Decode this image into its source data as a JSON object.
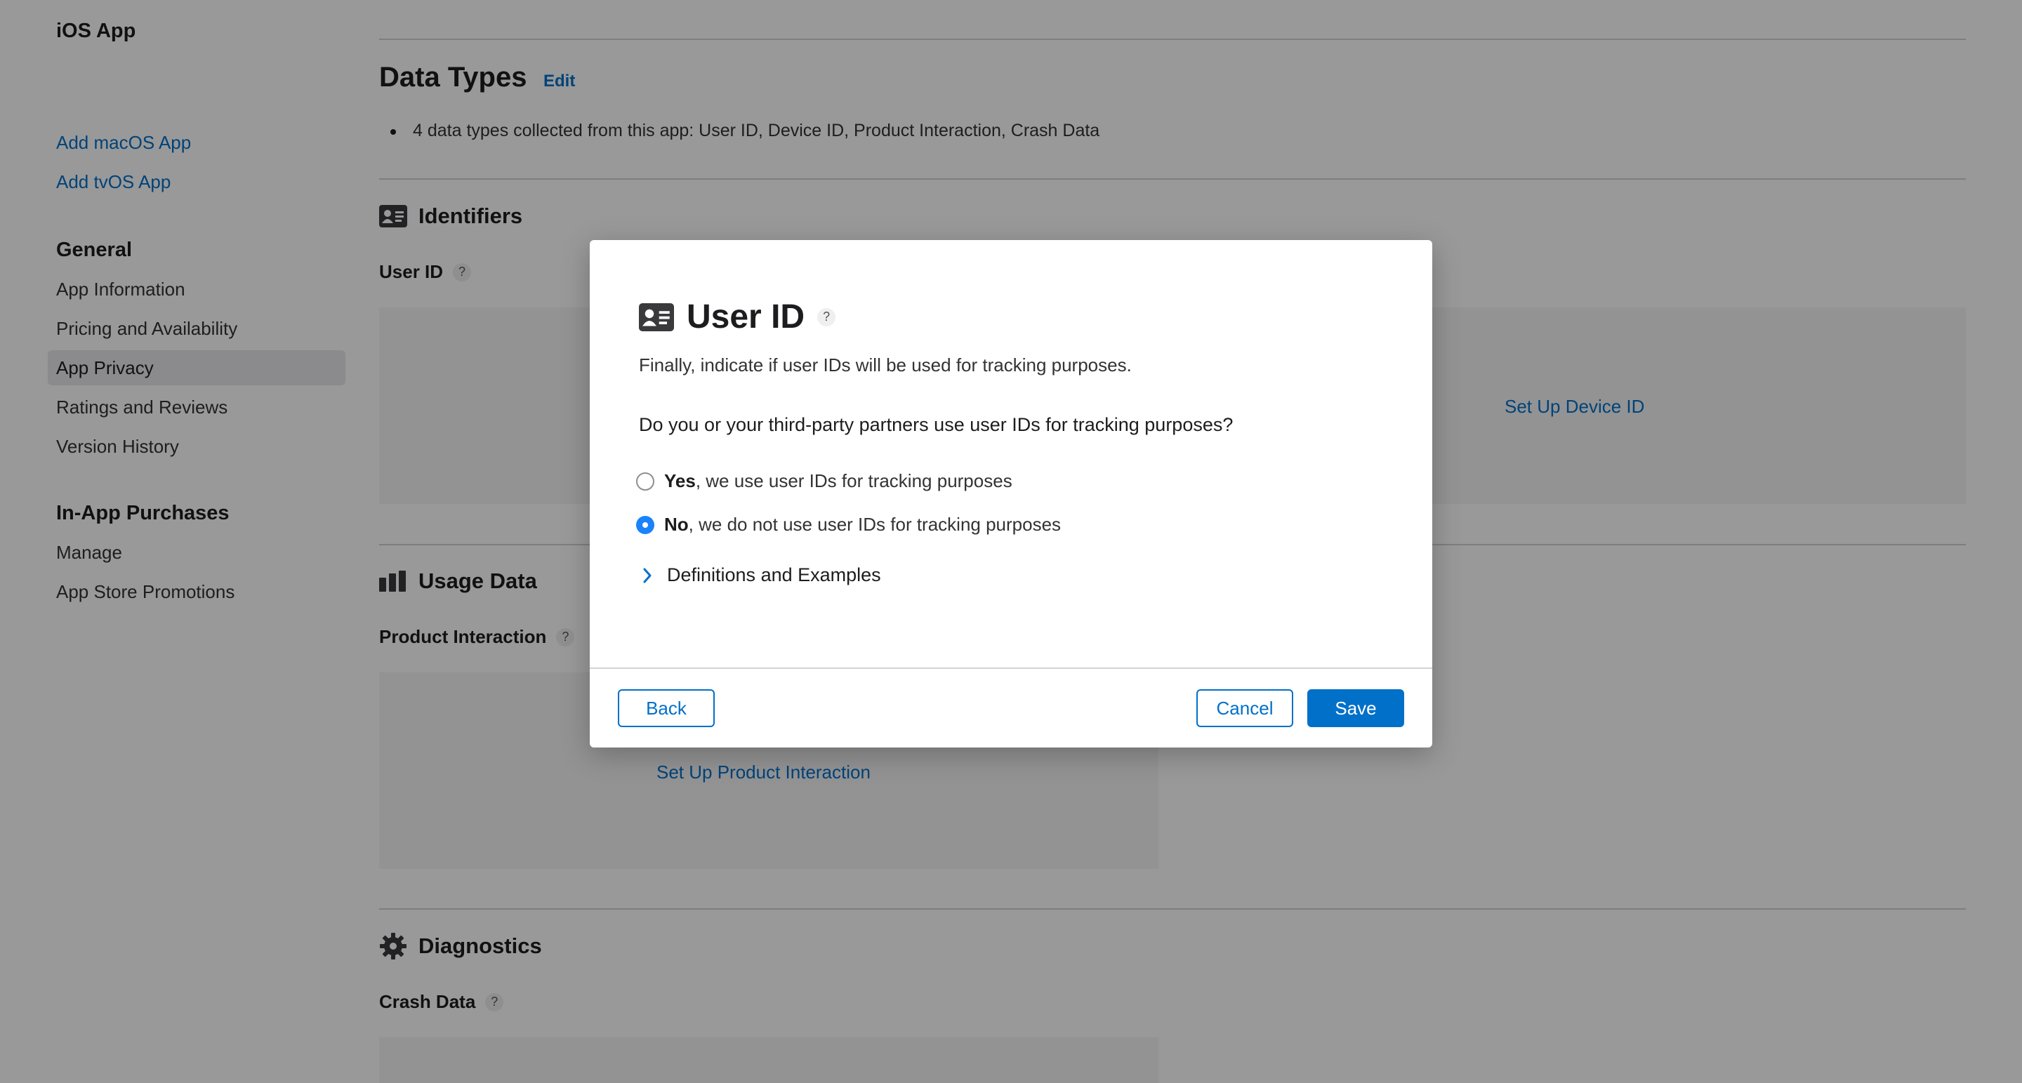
{
  "sidebar": {
    "app_title": "iOS App",
    "add_macos": "Add macOS App",
    "add_tvos": "Add tvOS App",
    "general_heading": "General",
    "general_items": [
      "App Information",
      "Pricing and Availability",
      "App Privacy",
      "Ratings and Reviews",
      "Version History"
    ],
    "iap_heading": "In-App Purchases",
    "iap_items": [
      "Manage",
      "App Store Promotions"
    ]
  },
  "main": {
    "data_types_title": "Data Types",
    "edit_label": "Edit",
    "collected_summary": "4 data types collected from this app: User ID, Device ID, Product Interaction, Crash Data",
    "identifiers": {
      "heading": "Identifiers",
      "icon": "contact-card-icon",
      "field": "User ID",
      "setup_device_id": "Set Up Device ID"
    },
    "usage": {
      "heading": "Usage Data",
      "icon": "bar-chart-icon",
      "field": "Product Interaction",
      "setup_link": "Set Up Product Interaction"
    },
    "diagnostics": {
      "heading": "Diagnostics",
      "icon": "gear-icon",
      "field": "Crash Data"
    },
    "help_badge": "?"
  },
  "modal": {
    "title": "User ID",
    "icon": "contact-card-icon",
    "help_badge": "?",
    "description": "Finally, indicate if user IDs will be used for tracking purposes.",
    "question": "Do you or your third-party partners use user IDs for tracking purposes?",
    "options": [
      {
        "bold": "Yes",
        "rest": ", we use user IDs for tracking purposes",
        "selected": false
      },
      {
        "bold": "No",
        "rest": ", we do not use user IDs for tracking purposes",
        "selected": true
      }
    ],
    "disclosure_label": "Definitions and Examples",
    "back_label": "Back",
    "cancel_label": "Cancel",
    "save_label": "Save"
  },
  "colors": {
    "accent": "#0070c9",
    "radio_selected": "#1a82fb",
    "overlay": "rgba(0,0,0,0.4)"
  }
}
